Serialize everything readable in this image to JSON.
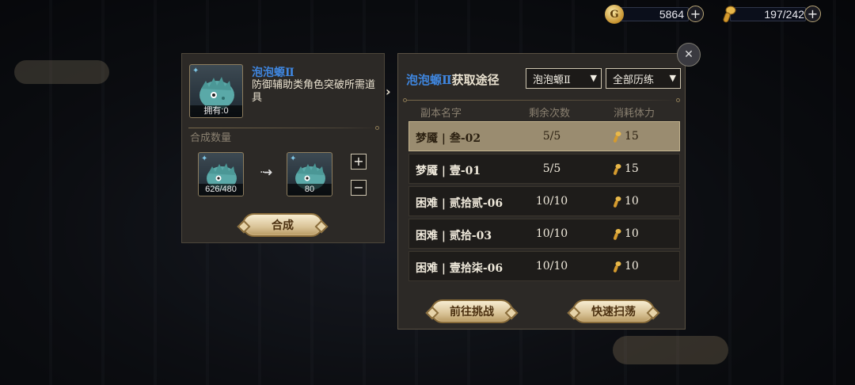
{
  "currency": {
    "coins": {
      "icon": "coin-icon",
      "value": "5864"
    },
    "stamina": {
      "icon": "stamina-icon",
      "value": "197/242"
    }
  },
  "synthesis": {
    "item_name": "泡泡螈Ⅱ",
    "item_desc": "防御辅助类角色突破所需道具",
    "owned_label": "拥有:0",
    "section_label": "合成数量",
    "source_count": "626/480",
    "target_count": "80",
    "plus_label": "+",
    "minus_label": "−",
    "synth_button": "合成"
  },
  "sources": {
    "title_accent": "泡泡螈Ⅱ",
    "title_rest": "获取途径",
    "filter_item": "泡泡螈Ⅱ",
    "filter_scope": "全部历练",
    "headers": {
      "name": "副本名字",
      "remaining": "剩余次数",
      "cost": "消耗体力"
    },
    "rows": [
      {
        "name": "梦魇 | 叁-02",
        "remaining": "5/5",
        "cost": "15",
        "selected": true
      },
      {
        "name": "梦魇 | 壹-01",
        "remaining": "5/5",
        "cost": "15",
        "selected": false
      },
      {
        "name": "困难 | 贰拾贰-06",
        "remaining": "10/10",
        "cost": "10",
        "selected": false
      },
      {
        "name": "困难 | 贰拾-03",
        "remaining": "10/10",
        "cost": "10",
        "selected": false
      },
      {
        "name": "困难 | 壹拾柒-06",
        "remaining": "10/10",
        "cost": "10",
        "selected": false
      }
    ],
    "go_button": "前往挑战",
    "sweep_button": "快速扫荡"
  },
  "colors": {
    "accent_blue": "#3f86df",
    "panel_bg": "#2c2926",
    "gold": "#d9c397",
    "selected_row": "#9a8c70"
  }
}
